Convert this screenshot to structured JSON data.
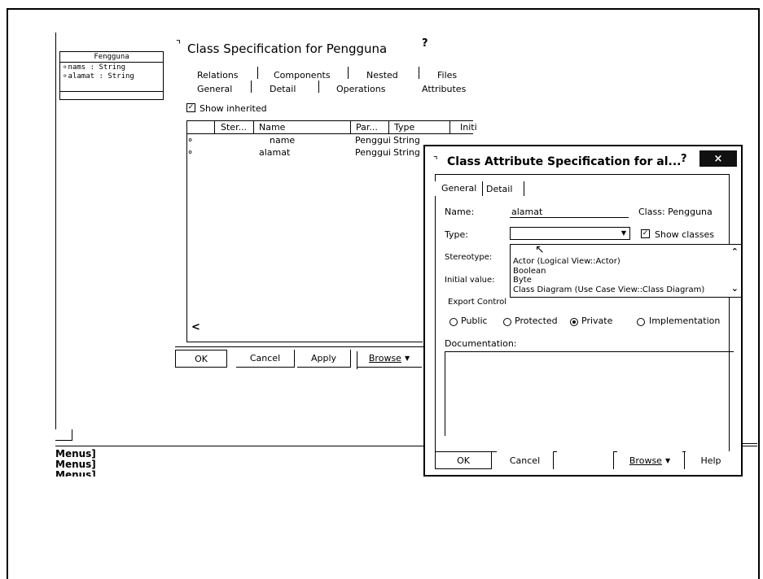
{
  "class_box": {
    "title": "Fengguna",
    "attrs": [
      "nams : String",
      "alamat : String"
    ]
  },
  "spec": {
    "title": "Class Specification for Pengguna",
    "help": "?",
    "tabs_row1": [
      "Relations",
      "Components",
      "Nested",
      "Files"
    ],
    "tabs_row2": [
      "General",
      "Detail",
      "Operations",
      "Attributes"
    ],
    "show_inherited": "Show inherited",
    "columns": [
      "Ster...",
      "Name",
      "Par...",
      "Type",
      "Initi"
    ],
    "rows": [
      {
        "name": "name",
        "parent": "Penggui",
        "type": "String"
      },
      {
        "name": "alamat",
        "parent": "Penggui",
        "type": "String"
      }
    ],
    "scroll_left": "<",
    "buttons": {
      "ok": "OK",
      "cancel": "Cancel",
      "apply": "Apply",
      "browse": "Browse"
    }
  },
  "attr_dialog": {
    "title": "Class Attribute Specification for al...",
    "help": "?",
    "close": "×",
    "tabs": [
      "General",
      "Detail"
    ],
    "name_label": "Name:",
    "name_value": "alamat",
    "class_label": "Class: Pengguna",
    "type_label": "Type:",
    "type_value": "",
    "show_classes": "Show classes",
    "stereotype_label": "Stereotype:",
    "initial_value_label": "Initial value:",
    "type_options": [
      "Actor (Logical View::Actor)",
      "Boolean",
      "Byte",
      "Class Diagram   (Use Case View::Class Diagram)"
    ],
    "export_control": "Export Control",
    "radios": [
      "Public",
      "Protected",
      "Private",
      "Implementation"
    ],
    "selected_radio": "Private",
    "documentation_label": "Documentation:",
    "buttons": {
      "ok": "OK",
      "cancel": "Cancel",
      "browse": "Browse",
      "help": "Help"
    }
  },
  "menus": [
    "Menus]",
    "Menus]",
    "Menus]"
  ]
}
